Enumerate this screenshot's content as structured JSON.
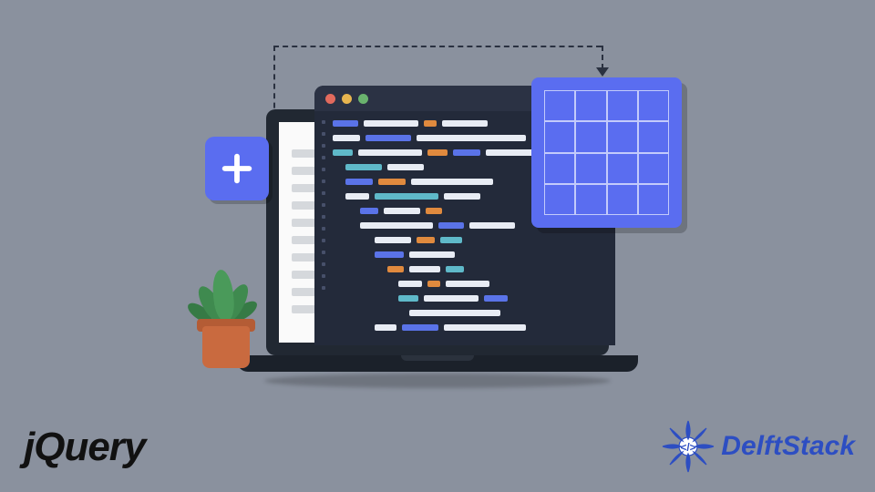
{
  "branding": {
    "left_logo": "jQuery",
    "right_logo": "DelftStack"
  },
  "icons": {
    "plus": "plus-icon",
    "grid": "grid-icon",
    "code": "code-icon"
  },
  "colors": {
    "background": "#8a919e",
    "accent_blue": "#5a6df0",
    "code_window": "#232a3a",
    "code_blue": "#5a73e8",
    "code_white": "#e8ecf4",
    "code_orange": "#e08a3e",
    "code_cyan": "#5fb9c9",
    "laptop_frame": "#212832",
    "logo_blue": "#2d4ec2",
    "pot": "#c96a3f",
    "leaf": "#4a9a5a"
  },
  "window_controls": {
    "close": "red",
    "minimize": "yellow",
    "maximize": "green"
  }
}
